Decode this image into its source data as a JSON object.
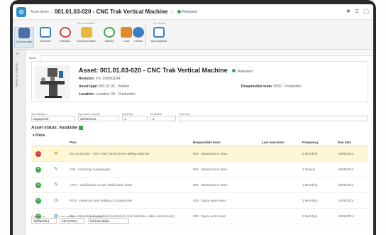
{
  "window": {
    "breadcrumb": "Asset items",
    "title": "001.01.03-020 - CNC Trak Vertical Machine",
    "status": "Released",
    "icons": [
      "pin-icon",
      "menu-icon",
      "help-icon"
    ]
  },
  "ribbon": {
    "group1_label": "View available",
    "group2_label": "Set status",
    "buttons": [
      {
        "label": "General data",
        "icon": "general-data-icon",
        "color": "#4a6fa5"
      },
      {
        "label": "Structure",
        "icon": "structure-icon",
        "color": "#3d7fc4"
      },
      {
        "label": "Indicator",
        "icon": "indicator-icon",
        "color": "#d04040"
      },
      {
        "label": "Documentation",
        "icon": "documentation-icon",
        "color": "#d4a020"
      },
      {
        "label": "History",
        "icon": "history-icon",
        "color": "#3aa848"
      },
      {
        "label": "Cost",
        "icon": "cost-icon",
        "color": "#e08a2a"
      },
      {
        "label": "Centre",
        "icon": "centre-icon",
        "color": "#3d7fc4"
      },
      {
        "label": "Associations",
        "icon": "associations-icon",
        "color": "#3d7fc4"
      }
    ]
  },
  "sidebar": {
    "label": "OBJECT ACTIONS"
  },
  "tab": "Asset",
  "asset": {
    "title": "Asset: 001.01.03-020 - CNC Trak Vertical Machine",
    "status": "Released",
    "revision_label": "Revision:",
    "revision_value": "0 in 10/06/2014",
    "type_label": "Asset type:",
    "type_value": "001.01.03 - Vehicle",
    "location_label": "Location:",
    "location_value": "Location: 03 - Production",
    "team_label": "Responsible team:",
    "team_value": "PRO - Production"
  },
  "fields": [
    {
      "label": "Specification",
      "value": "Equipment"
    },
    {
      "label": "Operation started",
      "value": "29/09/2013"
    },
    {
      "label": "Quantity",
      "value": "1"
    },
    {
      "label": "Available",
      "value": "1"
    },
    {
      "label": "Calendar",
      "value": ""
    }
  ],
  "availability": {
    "label": "Asset status: Available"
  },
  "plans": {
    "label": "Plans",
    "headers": [
      "Plan",
      "Responsible team",
      "Last execution",
      "Frequency",
      "Due date"
    ],
    "rows": [
      {
        "plan": "001.01.03-020 - CNC Trak Vertical Knee Milling Machine",
        "team": "001 - Maintenance team",
        "last": "",
        "freq": "6 Month(s)",
        "due": "15/05/2014",
        "status": "red",
        "icon": "wrench-icon",
        "selected": true
      },
      {
        "plan": "C05 - Cleaning of guideways",
        "team": "001 - Maintenance team",
        "last": "",
        "freq": "1 Year(s)",
        "due": "15/08/2014",
        "status": "green",
        "icon": "brush-icon",
        "selected": false
      },
      {
        "plan": "LP01 - Lubrification as per lubrification chart",
        "team": "001 - Maintenance team",
        "last": "",
        "freq": "1 Month(s)",
        "due": "15/06/2014",
        "status": "green",
        "icon": "oil-icon",
        "selected": false
      },
      {
        "plan": "IP03 - Inspection and refilling of coolant tank",
        "team": "002 - Spare parts team",
        "last": "",
        "freq": "2 Month(s)",
        "due": "15/06/2014",
        "status": "green",
        "icon": "gauge-icon",
        "selected": false
      },
      {
        "plan": "IE1 - Inspection of electrical (contactors, limit switches, cable connections)",
        "team": "002 - Spare parts team",
        "last": "",
        "freq": "2 Month(s)",
        "due": "15/06/2014",
        "status": "green",
        "icon": "clipboard-icon",
        "selected": false
      }
    ]
  },
  "footer": [
    {
      "label": "Created on",
      "value": "10/06/2014"
    },
    {
      "label": "Last updated",
      "value": "15/12/2014"
    },
    {
      "label": "Updated by",
      "value": "Michael Miller"
    }
  ]
}
